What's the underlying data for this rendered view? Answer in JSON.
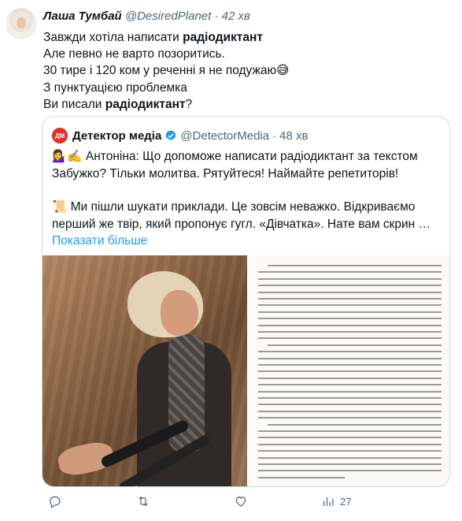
{
  "author": {
    "name": "Лаша Тумбай",
    "handle": "@DesiredPlanet",
    "dot": "·",
    "time": "42 хв"
  },
  "text": {
    "l1_pre": "Завжди хотіла написати ",
    "l1_bold": "радіодиктант",
    "l2": "Але певно не варто позоритись.",
    "l3": "30 тире і 120 ком у реченні я не подужаю😅",
    "l4": "З пунктуацією проблемка",
    "l5_pre": "Ви писали ",
    "l5_bold": "радіодиктант",
    "l5_post": "?"
  },
  "quote": {
    "avatar_text": "ДМ",
    "name": "Детектор медіа",
    "handle": "@DetectorMedia",
    "dot": "·",
    "time": "48 хв",
    "p1_l1": "💁‍♀️✍️ Антоніна: Що допоможе написати радіодиктант за текстом",
    "p1_l2": "Забужко? Тільки молитва. Рятуйтеся! Наймайте репетиторів!",
    "p2_l1": "📜 Ми пішли шукати приклади. Це зовсім неважко. Відкриваємо",
    "p2_l2": "перший же твір, який пропонує гугл. «Дівчатка». Нате вам скрин …",
    "show_more": "Показати більше"
  },
  "actions": {
    "reply_count": "",
    "retweet_count": "",
    "like_count": "",
    "views_count": "27"
  },
  "colors": {
    "accent": "#1d9bf0",
    "secondary_text": "#536471",
    "border": "#cfd9de",
    "detector_red": "#e0302d"
  },
  "icons": {
    "reply": "reply-icon",
    "retweet": "retweet-icon",
    "like": "heart-icon",
    "views": "views-chart-icon",
    "verified": "verified-badge-icon"
  }
}
